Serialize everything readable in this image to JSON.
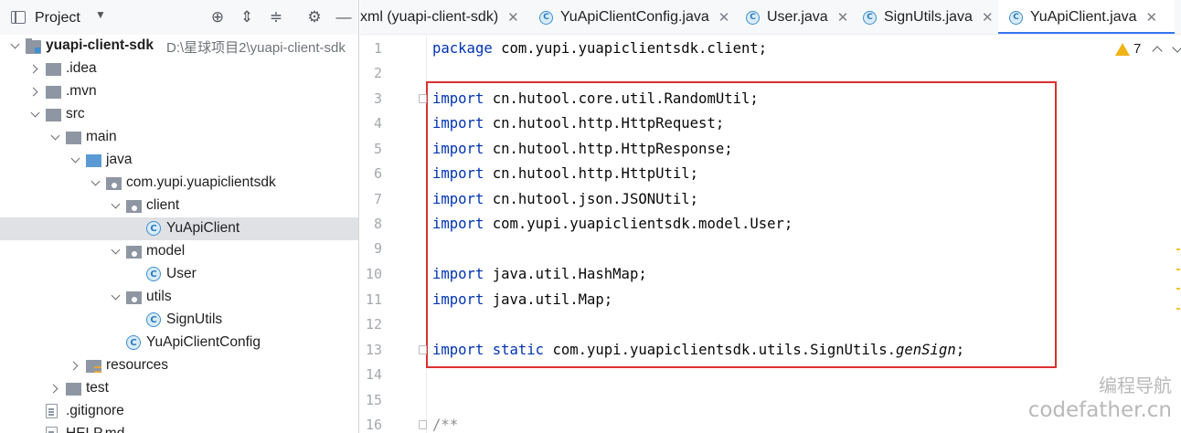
{
  "project_panel": {
    "title": "Project",
    "dropdown_icon": "chevron-down-icon",
    "header_buttons": [
      "crosshair-icon",
      "expand-all-icon",
      "collapse-all-icon",
      "gear-icon",
      "minimize-icon"
    ],
    "tree": [
      {
        "label": "yuapi-client-sdk",
        "hint": "D:\\星球项目2\\yuapi-client-sdk",
        "icon": "module-icon",
        "state": "expanded"
      },
      {
        "label": ".idea",
        "icon": "folder-icon",
        "state": "collapsed"
      },
      {
        "label": ".mvn",
        "icon": "folder-icon",
        "state": "collapsed"
      },
      {
        "label": "src",
        "icon": "folder-icon",
        "state": "expanded"
      },
      {
        "label": "main",
        "icon": "folder-icon",
        "state": "expanded"
      },
      {
        "label": "java",
        "icon": "source-folder-icon",
        "state": "expanded"
      },
      {
        "label": "com.yupi.yuapiclientsdk",
        "icon": "package-icon",
        "state": "expanded"
      },
      {
        "label": "client",
        "icon": "package-icon",
        "state": "expanded"
      },
      {
        "label": "YuApiClient",
        "icon": "java-class-icon",
        "state": "selected"
      },
      {
        "label": "model",
        "icon": "package-icon",
        "state": "expanded"
      },
      {
        "label": "User",
        "icon": "java-class-icon",
        "state": "leaf"
      },
      {
        "label": "utils",
        "icon": "package-icon",
        "state": "expanded"
      },
      {
        "label": "SignUtils",
        "icon": "java-class-icon",
        "state": "leaf"
      },
      {
        "label": "YuApiClientConfig",
        "icon": "java-class-icon",
        "state": "leaf"
      },
      {
        "label": "resources",
        "icon": "resources-folder-icon",
        "state": "collapsed"
      },
      {
        "label": "test",
        "icon": "folder-icon",
        "state": "collapsed"
      },
      {
        "label": ".gitignore",
        "icon": "file-icon",
        "state": "leaf"
      },
      {
        "label": "HELP.md",
        "icon": "file-icon",
        "state": "leaf"
      }
    ]
  },
  "editor": {
    "tabs": [
      {
        "label": "xml (yuapi-client-sdk)",
        "icon": "",
        "active": false
      },
      {
        "label": "YuApiClientConfig.java",
        "icon": "java-class-icon",
        "active": false
      },
      {
        "label": "User.java",
        "icon": "java-class-icon",
        "active": false
      },
      {
        "label": "SignUtils.java",
        "icon": "java-class-icon",
        "active": false
      },
      {
        "label": "YuApiClient.java",
        "icon": "java-class-icon",
        "active": true
      }
    ],
    "close_glyph": "✕",
    "class_glyph": "C",
    "warning_count": "7",
    "lines": [
      {
        "n": "1",
        "parts": [
          [
            "kw",
            "package"
          ],
          [
            "",
            " com.yupi.yuapiclientsdk.client;"
          ]
        ]
      },
      {
        "n": "2",
        "parts": []
      },
      {
        "n": "3",
        "parts": [
          [
            "kw",
            "import"
          ],
          [
            "",
            " cn.hutool.core.util.RandomUtil;"
          ]
        ]
      },
      {
        "n": "4",
        "parts": [
          [
            "kw",
            "import"
          ],
          [
            "",
            " cn.hutool.http.HttpRequest;"
          ]
        ]
      },
      {
        "n": "5",
        "parts": [
          [
            "kw",
            "import"
          ],
          [
            "",
            " cn.hutool.http.HttpResponse;"
          ]
        ]
      },
      {
        "n": "6",
        "parts": [
          [
            "kw",
            "import"
          ],
          [
            "",
            " cn.hutool.http.HttpUtil;"
          ]
        ]
      },
      {
        "n": "7",
        "parts": [
          [
            "kw",
            "import"
          ],
          [
            "",
            " cn.hutool.json.JSONUtil;"
          ]
        ]
      },
      {
        "n": "8",
        "parts": [
          [
            "kw",
            "import"
          ],
          [
            "",
            " com.yupi.yuapiclientsdk.model.User;"
          ]
        ]
      },
      {
        "n": "9",
        "parts": []
      },
      {
        "n": "10",
        "parts": [
          [
            "kw",
            "import"
          ],
          [
            "",
            " java.util.HashMap;"
          ]
        ]
      },
      {
        "n": "11",
        "parts": [
          [
            "kw",
            "import"
          ],
          [
            "",
            " java.util.Map;"
          ]
        ]
      },
      {
        "n": "12",
        "parts": []
      },
      {
        "n": "13",
        "parts": [
          [
            "kw",
            "import"
          ],
          [
            "",
            " "
          ],
          [
            "kw",
            "static"
          ],
          [
            "",
            " com.yupi.yuapiclientsdk.utils.SignUtils."
          ],
          [
            "it",
            "genSign"
          ],
          [
            "",
            ";"
          ]
        ]
      },
      {
        "n": "14",
        "parts": []
      },
      {
        "n": "15",
        "parts": []
      },
      {
        "n": "16",
        "parts": [
          [
            "cm",
            "/**"
          ]
        ]
      }
    ]
  },
  "watermark": {
    "line1": "编程导航",
    "line2": "codefather.cn"
  },
  "colors": {
    "keyword": "#0033b3",
    "highlight_border": "#d9312f",
    "active_tab_underline": "#3574f0",
    "selection": "#dfe1e5"
  }
}
